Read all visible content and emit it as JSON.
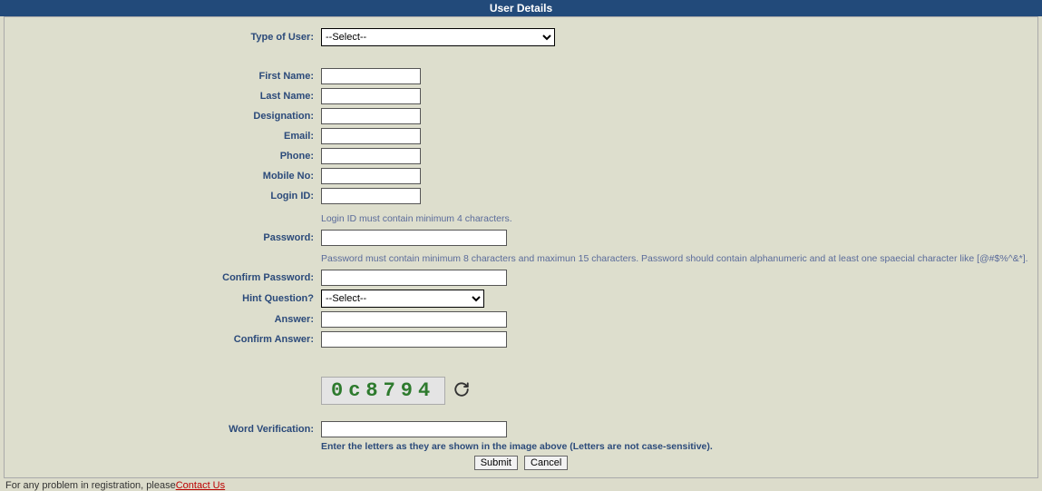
{
  "header": {
    "title": "User Details"
  },
  "form": {
    "typeOfUser": {
      "label": "Type of User:",
      "selected": "--Select--"
    },
    "firstName": {
      "label": "First Name:",
      "value": ""
    },
    "lastName": {
      "label": "Last Name:",
      "value": ""
    },
    "designation": {
      "label": "Designation:",
      "value": ""
    },
    "email": {
      "label": "Email:",
      "value": ""
    },
    "phone": {
      "label": "Phone:",
      "value": ""
    },
    "mobile": {
      "label": "Mobile No:",
      "value": ""
    },
    "loginId": {
      "label": "Login ID:",
      "value": "",
      "hint": "Login ID must contain minimum 4 characters."
    },
    "password": {
      "label": "Password:",
      "value": "",
      "hint": "Password must contain minimum 8 characters and maximun 15 characters. Password should contain alphanumeric and at least one spaecial character like [@#$%^&*]."
    },
    "confirmPassword": {
      "label": "Confirm Password:",
      "value": ""
    },
    "hintQuestion": {
      "label": "Hint Question?",
      "selected": "--Select--"
    },
    "answer": {
      "label": "Answer:",
      "value": ""
    },
    "confirmAnswer": {
      "label": "Confirm Answer:",
      "value": ""
    },
    "captcha": {
      "label": "Word Verification:",
      "image_text": "0c8794",
      "value": "",
      "hint": "Enter the letters as they are shown in the image above (Letters are not case-sensitive)."
    },
    "buttons": {
      "submit": "Submit",
      "cancel": "Cancel"
    }
  },
  "footer": {
    "text": "For any problem in registration, please",
    "link": "Contact Us"
  }
}
